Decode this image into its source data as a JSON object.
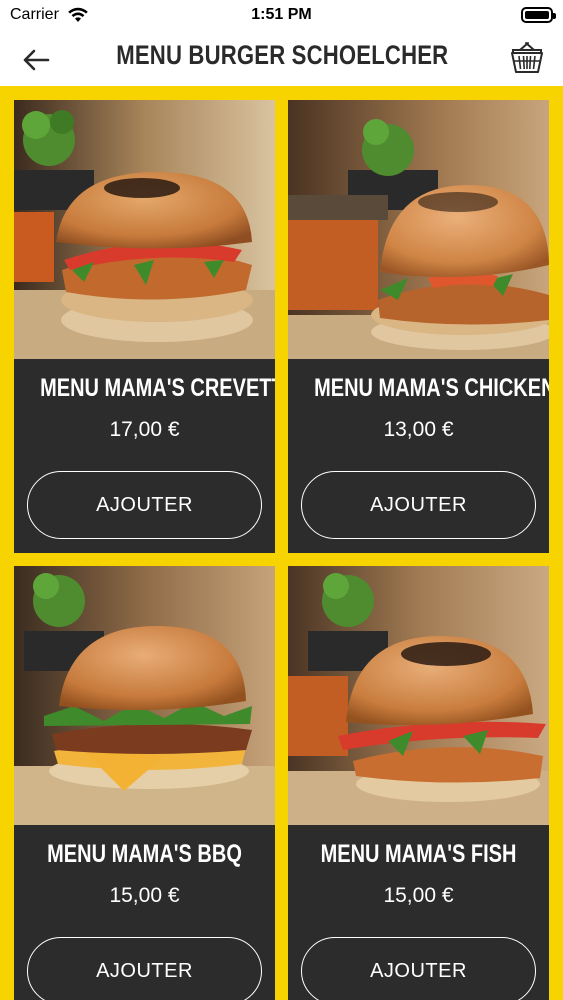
{
  "status_bar": {
    "carrier": "Carrier",
    "time": "1:51 PM",
    "wifi_icon": "wifi-icon",
    "battery_icon": "battery-icon"
  },
  "header": {
    "title": "MENU BURGER SCHOELCHER",
    "back_icon": "arrow-left-icon",
    "cart_icon": "basket-icon"
  },
  "theme": {
    "accent": "#f7d300",
    "card_background": "#2c2c2d",
    "text_on_card": "#ffffff",
    "title_color": "#2a2a2a"
  },
  "products": [
    {
      "name": "MENU MAMA'S CREVETTES",
      "price": "17,00 €",
      "button_label": "AJOUTER",
      "image": "burger-crevettes-photo"
    },
    {
      "name": "MENU MAMA'S CHICKEN",
      "price": "13,00 €",
      "button_label": "AJOUTER",
      "image": "burger-chicken-photo"
    },
    {
      "name": "MENU MAMA'S BBQ",
      "price": "15,00 €",
      "button_label": "AJOUTER",
      "image": "burger-bbq-photo"
    },
    {
      "name": "MENU MAMA'S FISH",
      "price": "15,00 €",
      "button_label": "AJOUTER",
      "image": "burger-fish-photo"
    }
  ]
}
